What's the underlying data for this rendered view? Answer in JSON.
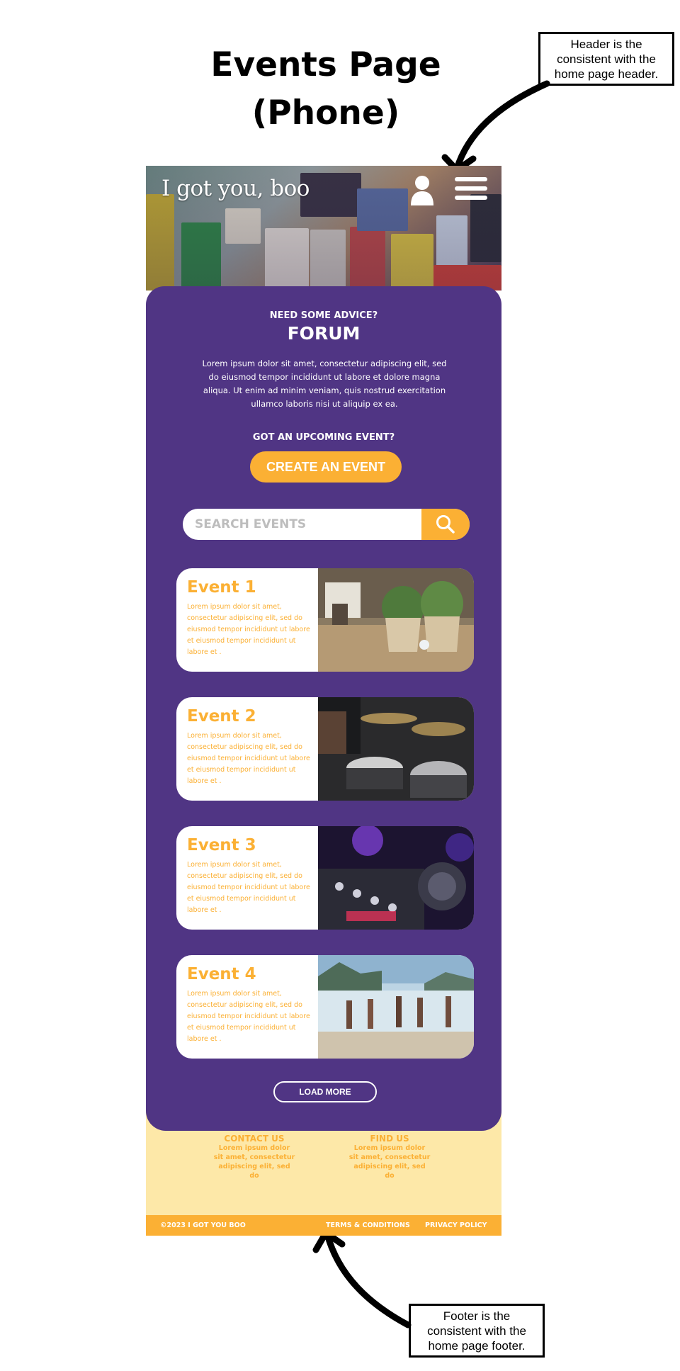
{
  "annotation": {
    "page_title_line1": "Events Page",
    "page_title_line2": "(Phone)",
    "header_note": "Header is the consistent with the home page header.",
    "footer_note": "Footer is the consistent with the home page footer."
  },
  "header": {
    "logo": "I got you, boo",
    "user_icon": "user-icon",
    "menu_icon": "hamburger-menu-icon"
  },
  "forum": {
    "eyebrow": "NEED SOME ADVICE?",
    "title": "FORUM",
    "body": "Lorem ipsum dolor sit amet, consectetur adipiscing elit, sed do eiusmod tempor incididunt ut labore et dolore magna aliqua. Ut enim ad minim veniam, quis nostrud exercitation ullamco laboris nisi ut aliquip ex ea."
  },
  "create": {
    "eyebrow": "GOT AN UPCOMING EVENT?",
    "button_label": "CREATE AN EVENT"
  },
  "search": {
    "placeholder": "SEARCH EVENTS",
    "icon": "search-icon"
  },
  "events": [
    {
      "title": "Event 1",
      "desc": "Lorem ipsum dolor sit amet, consectetur adipiscing elit, sed do eiusmod tempor incididunt ut labore et eiusmod tempor incididunt ut labore et ."
    },
    {
      "title": "Event 2",
      "desc": "Lorem ipsum dolor sit amet, consectetur adipiscing elit, sed do eiusmod tempor incididunt ut labore et eiusmod tempor incididunt ut labore et ."
    },
    {
      "title": "Event 3",
      "desc": "Lorem ipsum dolor sit amet, consectetur adipiscing elit, sed do eiusmod tempor incididunt ut labore et eiusmod tempor incididunt ut labore et ."
    },
    {
      "title": "Event 4",
      "desc": "Lorem ipsum dolor sit amet, consectetur adipiscing elit, sed do eiusmod tempor incididunt ut labore et eiusmod tempor incididunt ut labore et ."
    }
  ],
  "load_more": "LOAD MORE",
  "footer": {
    "contact_title": "CONTACT US",
    "contact_text": "Lorem ipsum dolor sit amet, consectetur adipiscing elit, sed do",
    "find_title": "FIND US",
    "find_text": "Lorem ipsum dolor sit amet, consectetur adipiscing elit, sed do",
    "copyright": "©2023   I GOT YOU BOO",
    "terms": "TERMS & CONDITIONS",
    "privacy": "PRIVACY POLICY"
  },
  "colors": {
    "purple": "#503584",
    "accent": "#fbb034",
    "footer_bg": "#fde8a8"
  }
}
